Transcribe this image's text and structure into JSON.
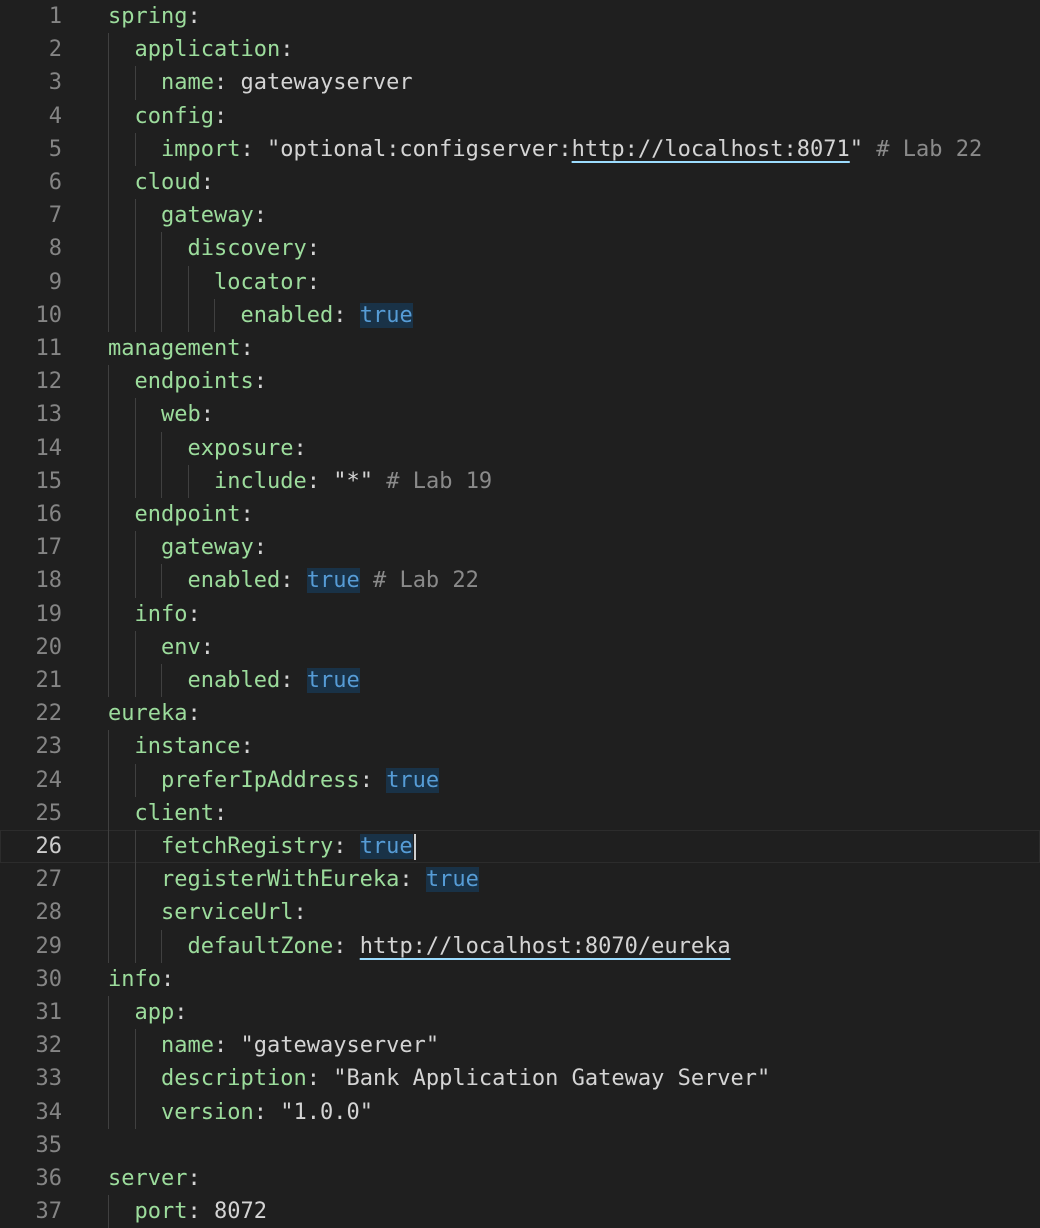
{
  "editor": {
    "current_line": 26,
    "lines": [
      {
        "n": "1",
        "indent": 0,
        "key": "spring",
        "colon": ":",
        "type": "none",
        "value": "",
        "comment": ""
      },
      {
        "n": "2",
        "indent": 1,
        "key": "application",
        "colon": ":",
        "type": "none",
        "value": "",
        "comment": ""
      },
      {
        "n": "3",
        "indent": 2,
        "key": "name",
        "colon": ":",
        "type": "plain",
        "value": "gatewayserver",
        "comment": ""
      },
      {
        "n": "4",
        "indent": 1,
        "key": "config",
        "colon": ":",
        "type": "none",
        "value": "",
        "comment": ""
      },
      {
        "n": "5",
        "indent": 2,
        "key": "import",
        "colon": ":",
        "type": "import",
        "value": "\"optional:configserver:http://localhost:8071\"",
        "url_prefix": "\"optional:configserver:",
        "url": "http://localhost:8071",
        "url_suffix": "\"",
        "comment": "# Lab 22"
      },
      {
        "n": "6",
        "indent": 1,
        "key": "cloud",
        "colon": ":",
        "type": "none",
        "value": "",
        "comment": ""
      },
      {
        "n": "7",
        "indent": 2,
        "key": "gateway",
        "colon": ":",
        "type": "none",
        "value": "",
        "comment": ""
      },
      {
        "n": "8",
        "indent": 3,
        "key": "discovery",
        "colon": ":",
        "type": "none",
        "value": "",
        "comment": ""
      },
      {
        "n": "9",
        "indent": 4,
        "key": "locator",
        "colon": ":",
        "type": "none",
        "value": "",
        "comment": ""
      },
      {
        "n": "10",
        "indent": 5,
        "key": "enabled",
        "colon": ":",
        "type": "bool",
        "value": "true",
        "comment": ""
      },
      {
        "n": "11",
        "indent": 0,
        "key": "management",
        "colon": ":",
        "type": "none",
        "value": "",
        "comment": ""
      },
      {
        "n": "12",
        "indent": 1,
        "key": "endpoints",
        "colon": ":",
        "type": "none",
        "value": "",
        "comment": ""
      },
      {
        "n": "13",
        "indent": 2,
        "key": "web",
        "colon": ":",
        "type": "none",
        "value": "",
        "comment": ""
      },
      {
        "n": "14",
        "indent": 3,
        "key": "exposure",
        "colon": ":",
        "type": "none",
        "value": "",
        "comment": ""
      },
      {
        "n": "15",
        "indent": 4,
        "key": "include",
        "colon": ":",
        "type": "plain",
        "value": "\"*\"",
        "comment": "# Lab 19"
      },
      {
        "n": "16",
        "indent": 1,
        "key": "endpoint",
        "colon": ":",
        "type": "none",
        "value": "",
        "comment": ""
      },
      {
        "n": "17",
        "indent": 2,
        "key": "gateway",
        "colon": ":",
        "type": "none",
        "value": "",
        "comment": ""
      },
      {
        "n": "18",
        "indent": 3,
        "key": "enabled",
        "colon": ":",
        "type": "bool",
        "value": "true",
        "comment": "# Lab 22"
      },
      {
        "n": "19",
        "indent": 1,
        "key": "info",
        "colon": ":",
        "type": "none",
        "value": "",
        "comment": ""
      },
      {
        "n": "20",
        "indent": 2,
        "key": "env",
        "colon": ":",
        "type": "none",
        "value": "",
        "comment": ""
      },
      {
        "n": "21",
        "indent": 3,
        "key": "enabled",
        "colon": ":",
        "type": "bool",
        "value": "true",
        "comment": ""
      },
      {
        "n": "22",
        "indent": 0,
        "key": "eureka",
        "colon": ":",
        "type": "none",
        "value": "",
        "comment": ""
      },
      {
        "n": "23",
        "indent": 1,
        "key": "instance",
        "colon": ":",
        "type": "none",
        "value": "",
        "comment": ""
      },
      {
        "n": "24",
        "indent": 2,
        "key": "preferIpAddress",
        "colon": ":",
        "type": "bool",
        "value": "true",
        "comment": ""
      },
      {
        "n": "25",
        "indent": 1,
        "key": "client",
        "colon": ":",
        "type": "none",
        "value": "",
        "comment": ""
      },
      {
        "n": "26",
        "indent": 2,
        "key": "fetchRegistry",
        "colon": ":",
        "type": "bool",
        "value": "true",
        "comment": "",
        "cursor": true
      },
      {
        "n": "27",
        "indent": 2,
        "key": "registerWithEureka",
        "colon": ":",
        "type": "bool",
        "value": "true",
        "comment": ""
      },
      {
        "n": "28",
        "indent": 2,
        "key": "serviceUrl",
        "colon": ":",
        "type": "none",
        "value": "",
        "comment": ""
      },
      {
        "n": "29",
        "indent": 3,
        "key": "defaultZone",
        "colon": ":",
        "type": "url",
        "value": "http://localhost:8070/eureka",
        "comment": ""
      },
      {
        "n": "30",
        "indent": 0,
        "key": "info",
        "colon": ":",
        "type": "none",
        "value": "",
        "comment": ""
      },
      {
        "n": "31",
        "indent": 1,
        "key": "app",
        "colon": ":",
        "type": "none",
        "value": "",
        "comment": ""
      },
      {
        "n": "32",
        "indent": 2,
        "key": "name",
        "colon": ":",
        "type": "plain",
        "value": "\"gatewayserver\"",
        "comment": ""
      },
      {
        "n": "33",
        "indent": 2,
        "key": "description",
        "colon": ":",
        "type": "plain",
        "value": "\"Bank Application Gateway Server\"",
        "comment": ""
      },
      {
        "n": "34",
        "indent": 2,
        "key": "version",
        "colon": ":",
        "type": "plain",
        "value": "\"1.0.0\"",
        "comment": ""
      },
      {
        "n": "35",
        "indent": 0,
        "key": "",
        "colon": "",
        "type": "none",
        "value": "",
        "comment": ""
      },
      {
        "n": "36",
        "indent": 0,
        "key": "server",
        "colon": ":",
        "type": "none",
        "value": "",
        "comment": ""
      },
      {
        "n": "37",
        "indent": 1,
        "key": "port",
        "colon": ":",
        "type": "plain",
        "value": "8072",
        "comment": ""
      }
    ]
  },
  "colors": {
    "background": "#1f1f1f",
    "key": "#9cdc9c",
    "bool": "#569cd6",
    "bool_bg": "#193247",
    "comment": "#8a8a8a",
    "line_number": "#858585",
    "indent_guide": "#404040"
  }
}
